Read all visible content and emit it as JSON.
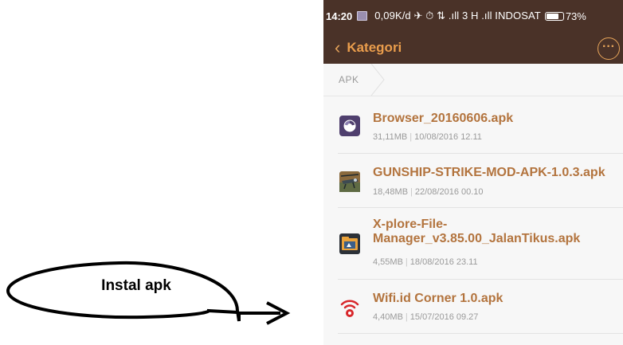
{
  "annotation": {
    "label": "Instal apk"
  },
  "status_bar": {
    "time": "14:20",
    "status_text": "0,09K/d ✈ ⏱ ⇅ .ıll 3 H .ıll INDOSAT",
    "battery": "73%"
  },
  "header": {
    "back_icon": "‹",
    "title": "Kategori",
    "more_icon": "···"
  },
  "breadcrumb": {
    "label": "APK"
  },
  "files": [
    {
      "name": "Browser_20160606.apk",
      "size": "31,11MB",
      "date": "10/08/2016 12.11",
      "icon": "browser-app-icon"
    },
    {
      "name": "GUNSHIP-STRIKE-MOD-APK-1.0.3.apk",
      "size": "18,48MB",
      "date": "22/08/2016 00.10",
      "icon": "gunship-game-icon"
    },
    {
      "name_line1": "X-plore-File-",
      "name_line2": "Manager_v3.85.00_JalanTikus.apk",
      "size": "4,55MB",
      "date": "18/08/2016 23.11",
      "icon": "xplore-file-manager-icon"
    },
    {
      "name": "Wifi.id Corner 1.0.apk",
      "size": "4,40MB",
      "date": "15/07/2016 09.27",
      "icon": "wifi-id-icon"
    }
  ],
  "colors": {
    "header_bg": "#4a3228",
    "accent": "#ea9d4c",
    "file_name": "#b3743e"
  }
}
